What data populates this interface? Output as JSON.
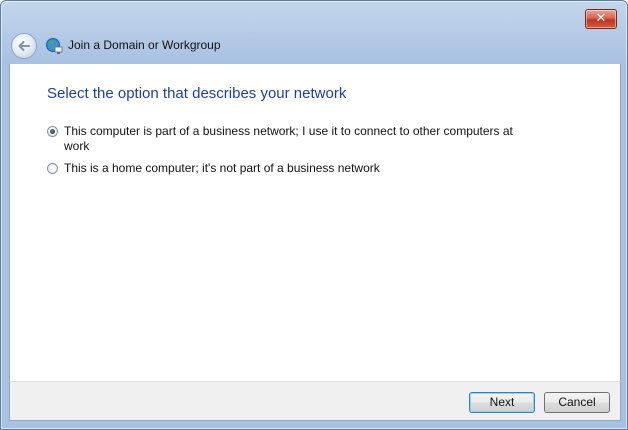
{
  "window": {
    "close_glyph": "✕"
  },
  "header": {
    "title": "Join a Domain or Workgroup",
    "back_icon": "back-arrow-icon",
    "wizard_icon": "network-globe-icon"
  },
  "main": {
    "heading": "Select the option that describes your network",
    "options": [
      {
        "label": "This computer is part of a business network; I use it to connect to other computers at work",
        "selected": true
      },
      {
        "label": "This is a home computer; it's not part of a business network",
        "selected": false
      }
    ]
  },
  "footer": {
    "next_label": "Next",
    "cancel_label": "Cancel"
  },
  "colors": {
    "heading": "#1f3f9b",
    "chrome": "#b6cbe6",
    "close": "#c2331e"
  }
}
